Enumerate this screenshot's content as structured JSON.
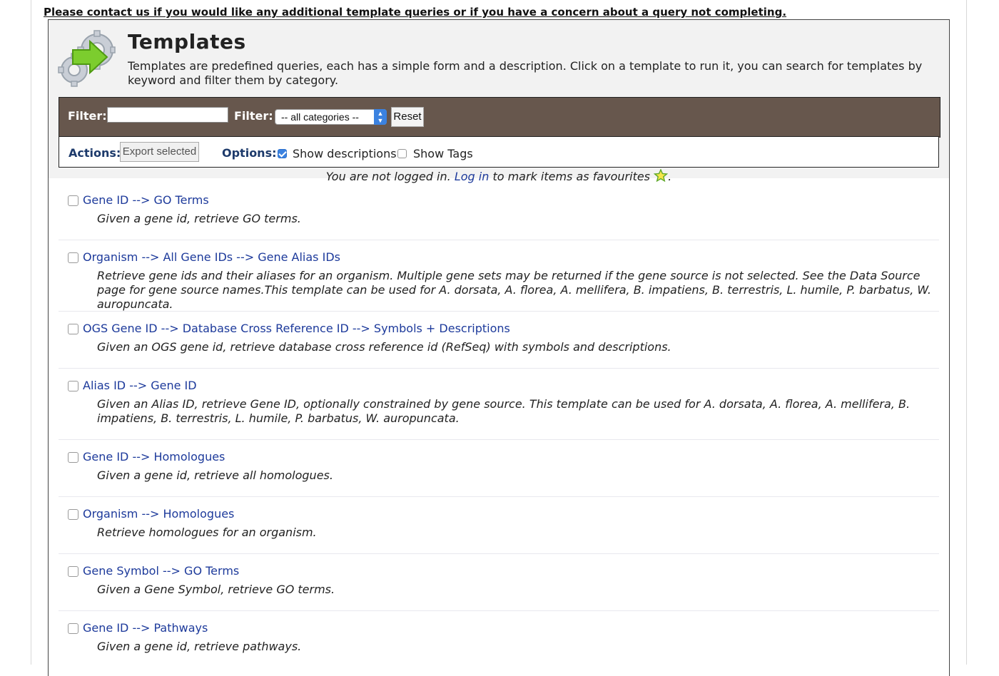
{
  "contact_message": "Please contact us if you would like any additional template queries or if you have a concern about a query not completing.",
  "header": {
    "title": "Templates",
    "description": "Templates are predefined queries, each has a simple form and a description. Click on a template to run it, you can search for templates by keyword and filter them by category."
  },
  "filters": {
    "keyword_label": "Filter:",
    "keyword_value": "",
    "category_label": "Filter:",
    "category_selected": "-- all categories --",
    "reset_label": "Reset"
  },
  "actions": {
    "actions_label": "Actions:",
    "export_label": "Export selected",
    "options_label": "Options:",
    "show_descriptions_label": "Show descriptions",
    "show_descriptions_checked": true,
    "show_tags_label": "Show Tags",
    "show_tags_checked": false
  },
  "login_notice": {
    "before": "You are not logged in.",
    "link": "Log in",
    "after": "to mark items as favourites",
    "end": "."
  },
  "templates": [
    {
      "title": "Gene ID --> GO Terms",
      "description": "Given a gene id, retrieve GO terms."
    },
    {
      "title": "Organism --> All Gene IDs --> Gene Alias IDs",
      "description": "Retrieve gene ids and their aliases for an organism. Multiple gene sets may be returned if the gene source is not selected. See the Data Source page for gene source names.This template can be used for A. dorsata, A. florea, A. mellifera, B. impatiens, B. terrestris, L. humile, P. barbatus, W. auropuncata."
    },
    {
      "title": "OGS Gene ID --> Database Cross Reference ID --> Symbols + Descriptions",
      "description": "Given an OGS gene id, retrieve database cross reference id (RefSeq) with symbols and descriptions."
    },
    {
      "title": "Alias ID --> Gene ID",
      "description": "Given an Alias ID, retrieve Gene ID, optionally constrained by gene source. This template can be used for A. dorsata, A. florea, A. mellifera, B. impatiens, B. terrestris, L. humile, P. barbatus, W. auropuncata."
    },
    {
      "title": "Gene ID --> Homologues",
      "description": "Given a gene id, retrieve all homologues."
    },
    {
      "title": "Organism --> Homologues",
      "description": "Retrieve homologues for an organism."
    },
    {
      "title": "Gene Symbol --> GO Terms",
      "description": "Given a Gene Symbol, retrieve GO terms."
    },
    {
      "title": "Gene ID --> Pathways",
      "description": "Given a gene id, retrieve pathways."
    }
  ],
  "colors": {
    "filter_bar_bg": "#67574d",
    "link_color": "#1d3a9b",
    "label_color": "#1d3a6b"
  }
}
